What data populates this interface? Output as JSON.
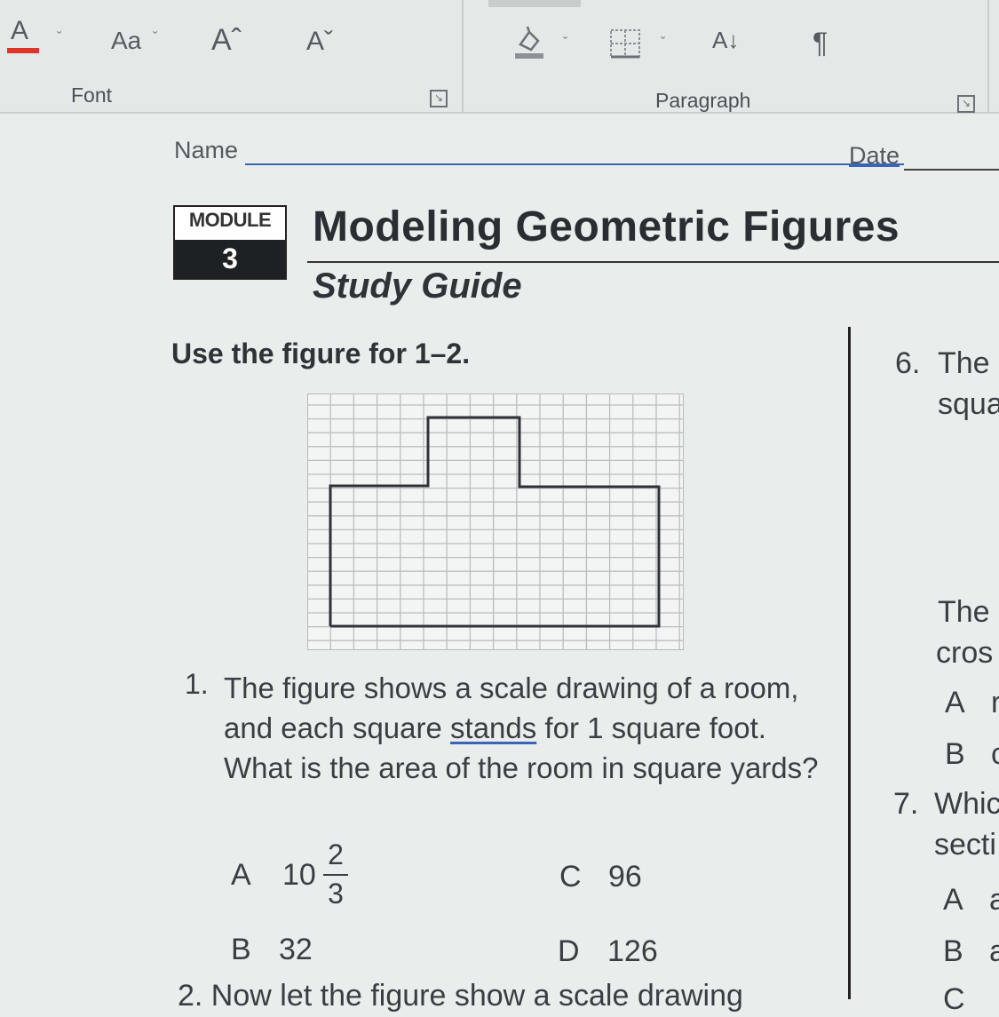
{
  "ribbon": {
    "font_color_icon": "A",
    "change_case": "Aa",
    "grow_font": "Aˆ",
    "shrink_font": "Aˇ",
    "font_group": "Font",
    "paragraph_group": "Paragraph",
    "pilcrow": "¶",
    "sort_icon": "A↓",
    "caret": "ˇ",
    "launcher": "↘"
  },
  "header": {
    "name_label": "Name",
    "date_label": "Date",
    "module_word": "MODULE",
    "module_number": "3",
    "title": "Modeling Geometric Figures",
    "subtitle": "Study Guide"
  },
  "instruction": "Use the figure for 1–2.",
  "question1": {
    "number": "1.",
    "text_a": "The figure shows a scale drawing of a room, and each square ",
    "text_link": "stands",
    "text_b": " for 1 square foot. What is the area of the room in square yards?",
    "options": {
      "a_letter": "A",
      "a_whole": "10",
      "a_num": "2",
      "a_den": "3",
      "b_letter": "B",
      "b_value": "32",
      "c_letter": "C",
      "c_value": "96",
      "d_letter": "D",
      "d_value": "126"
    }
  },
  "question2_cut": "2. Now let the figure show a scale drawing",
  "right_column": {
    "q6_num": "6.",
    "q6_word1": "The",
    "q6_word2": "squa",
    "line_the": "The",
    "line_cros": "cros",
    "opt_a": "A",
    "opt_a_rest": "r",
    "opt_b": "B",
    "opt_b_rest": "c",
    "q7_num": "7.",
    "q7_word": "Whic",
    "q7_line2": "secti",
    "q7_a": "A",
    "q7_a_rest": "a",
    "q7_b": "B",
    "q7_b_rest": "a",
    "q7_c": "C"
  },
  "colors": {
    "font_color_bar": "#e0342b",
    "link_underline": "#3b63b8"
  }
}
